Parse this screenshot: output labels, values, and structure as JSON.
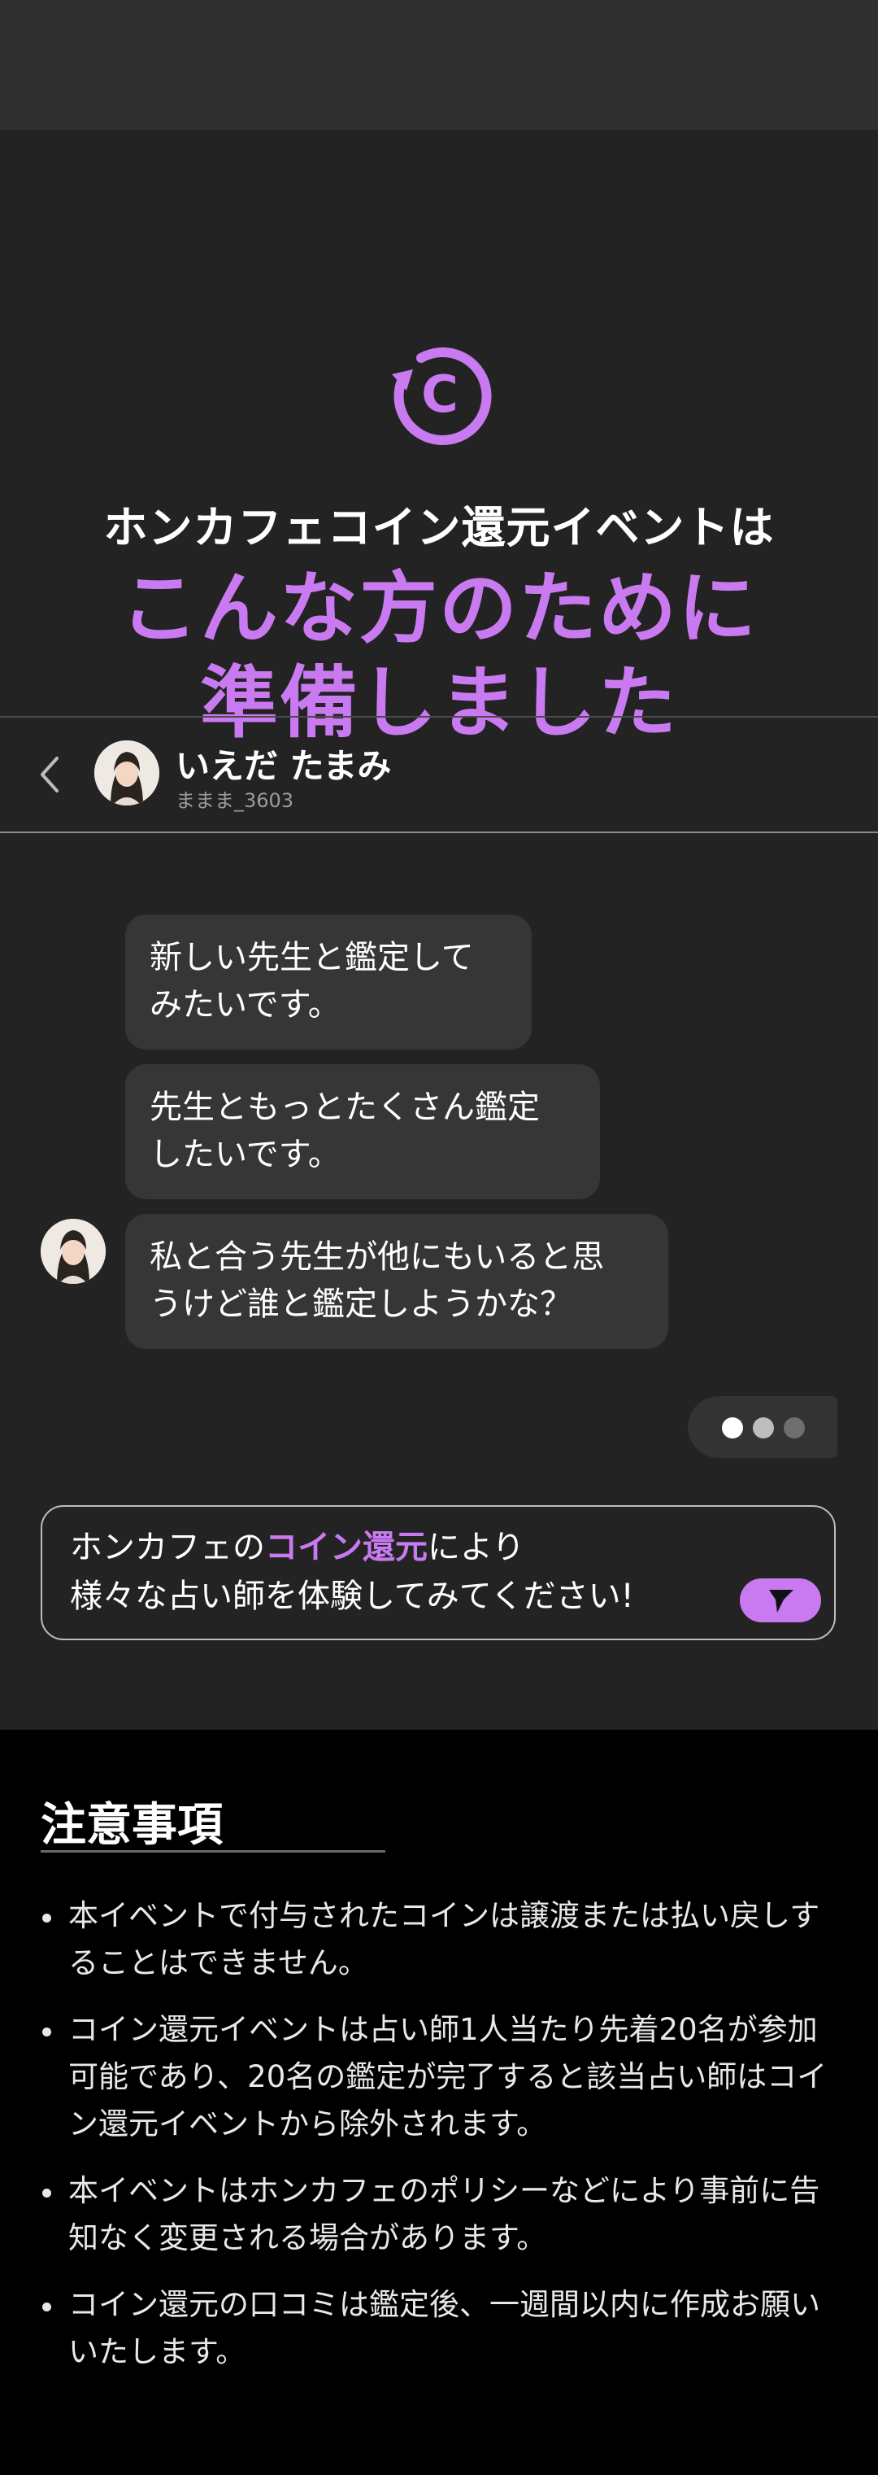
{
  "hero": {
    "icon": "coin-return-icon",
    "accent_color": "#c97af0",
    "subtitle": "ホンカフェコイン還元イベントは",
    "headline_line1": "こんな方のために",
    "headline_line2": "準備しました"
  },
  "chat": {
    "back_icon": "chevron-left-icon",
    "user_name": "いえだ たまみ",
    "user_id": "ままま_3603",
    "messages": [
      "新しい先生と鑑定して\nみたいです。",
      "先生ともっとたくさん鑑定\nしたいです。",
      "私と合う先生が他にもいると思\nうけど誰と鑑定しようかな？"
    ],
    "typing_indicator": "typing-dots-icon",
    "input_prefix": "ホンカフェの",
    "input_highlight": "コイン還元",
    "input_suffix": "により",
    "input_line2": "様々な占い師を体験してみてください!",
    "send_icon": "send-icon"
  },
  "notice": {
    "title": "注意事項",
    "items": [
      "本イベントで付与されたコインは譲渡または払い戻しすることはできません。",
      "コイン還元イベントは占い師1人当たり先着20名が参加可能であり、20名の鑑定が完了すると該当占い師はコイン還元イベントから除外されます。",
      "本イベントはホンカフェのポリシーなどにより事前に告知なく変更される場合があります。",
      "コイン還元の口コミは鑑定後、一週間以内に作成お願いいたします。"
    ]
  }
}
